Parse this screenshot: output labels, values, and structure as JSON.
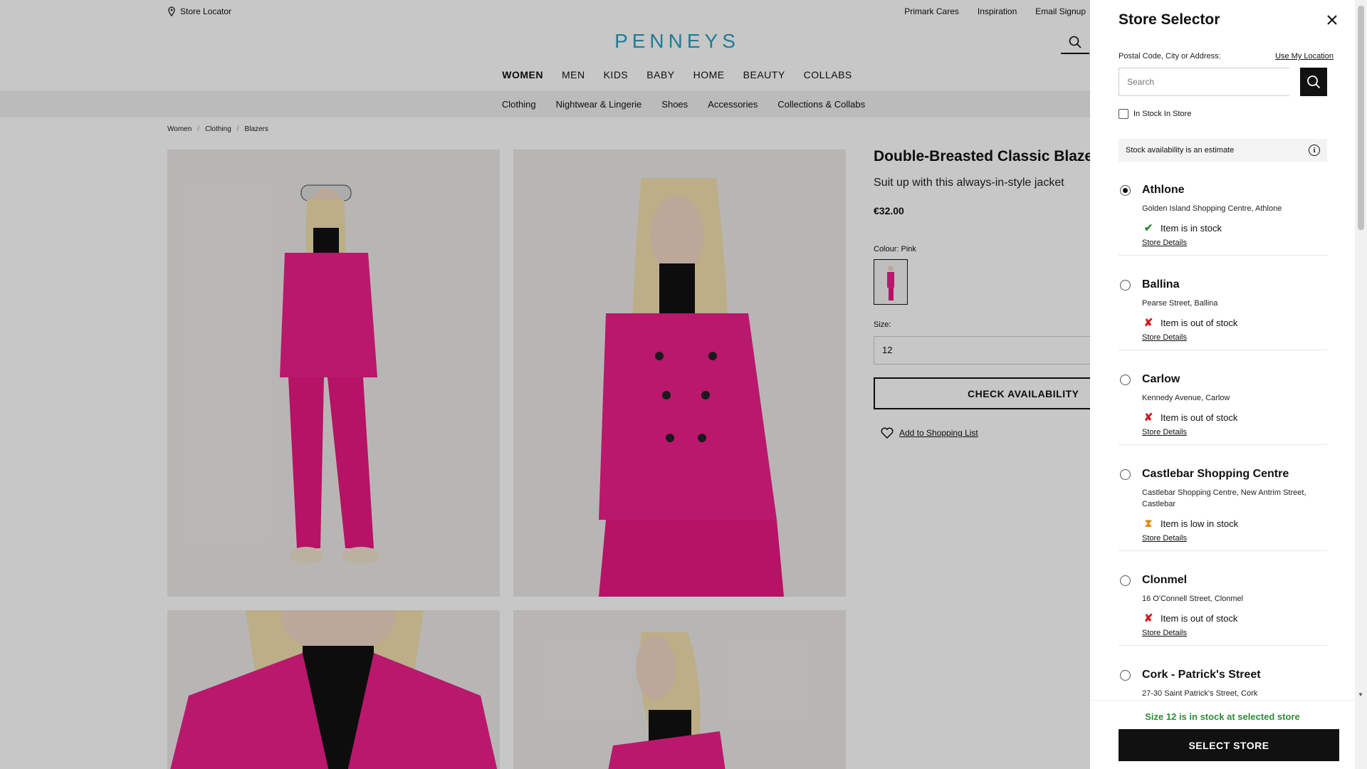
{
  "header": {
    "store_locator": "Store Locator",
    "top_links": [
      "Primark Cares",
      "Inspiration",
      "Email Signup"
    ],
    "logo": "PENNEYS",
    "main_nav": [
      {
        "label": "WOMEN",
        "active": true
      },
      {
        "label": "MEN",
        "active": false
      },
      {
        "label": "KIDS",
        "active": false
      },
      {
        "label": "BABY",
        "active": false
      },
      {
        "label": "HOME",
        "active": false
      },
      {
        "label": "BEAUTY",
        "active": false
      },
      {
        "label": "COLLABS",
        "active": false
      }
    ],
    "sub_nav": [
      "Clothing",
      "Nightwear & Lingerie",
      "Shoes",
      "Accessories",
      "Collections & Collabs"
    ]
  },
  "breadcrumb": [
    "Women",
    "Clothing",
    "Blazers"
  ],
  "product": {
    "title": "Double-Breasted Classic Blazer",
    "subtitle": "Suit up with this always-in-style jacket",
    "price": "€32.00",
    "colour_label": "Colour:",
    "colour_value": "Pink",
    "size_label": "Size:",
    "size_value": "12",
    "check_button": "CHECK AVAILABILITY",
    "shopping_list": "Add to Shopping List",
    "accent_color": "#ee1f8c"
  },
  "drawer": {
    "title": "Store Selector",
    "location_label": "Postal Code, City or Address:",
    "use_location": "Use My Location",
    "search_placeholder": "Search",
    "in_stock_label": "In Stock In Store",
    "info_text": "Stock availability is an estimate",
    "details_label": "Store Details",
    "stores": [
      {
        "name": "Athlone",
        "address": "Golden Island Shopping Centre, Athlone",
        "status": "ok",
        "stock": "Item is in stock",
        "selected": true
      },
      {
        "name": "Ballina",
        "address": "Pearse Street, Ballina",
        "status": "out",
        "stock": "Item is out of stock",
        "selected": false
      },
      {
        "name": "Carlow",
        "address": "Kennedy Avenue, Carlow",
        "status": "out",
        "stock": "Item is out of stock",
        "selected": false
      },
      {
        "name": "Castlebar Shopping Centre",
        "address": "Castlebar Shopping Centre, New Antrim Street, Castlebar",
        "status": "low",
        "stock": "Item is low in stock",
        "selected": false
      },
      {
        "name": "Clonmel",
        "address": "16 O'Connell Street, Clonmel",
        "status": "out",
        "stock": "Item is out of stock",
        "selected": false
      },
      {
        "name": "Cork - Patrick's Street",
        "address": "27-30 Saint Patrick's Street, Cork",
        "status": "",
        "stock": "",
        "selected": false
      }
    ],
    "footer_message": "Size 12 is in stock at selected store",
    "select_button": "SELECT STORE"
  }
}
